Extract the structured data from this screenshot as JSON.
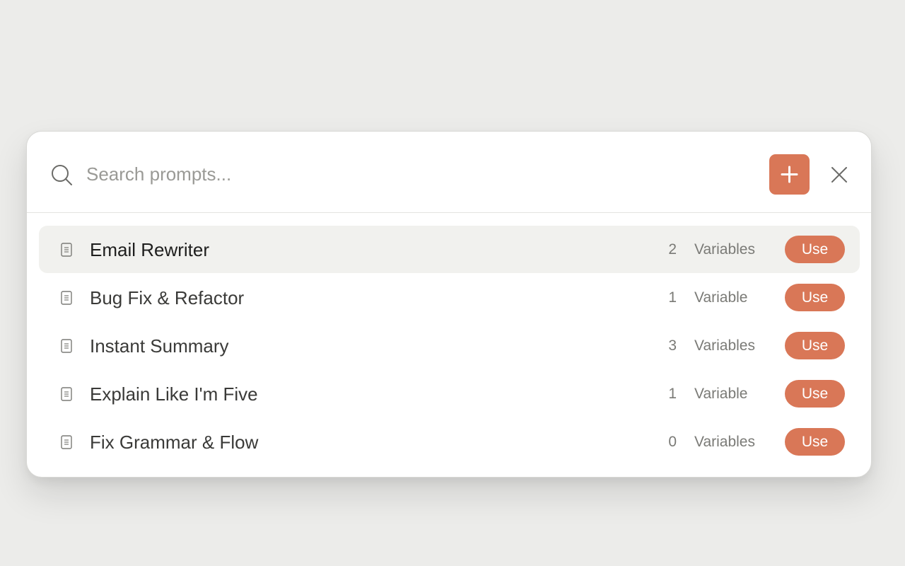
{
  "search": {
    "placeholder": "Search prompts..."
  },
  "toolbar": {
    "add_icon": "plus-icon",
    "close_icon": "close-icon"
  },
  "colors": {
    "accent": "#d97757",
    "active_row": "#f1f1ee",
    "background": "#ececea"
  },
  "prompts": [
    {
      "title": "Email Rewriter",
      "var_count": "2",
      "var_label": "Variables",
      "action": "Use",
      "active": true
    },
    {
      "title": "Bug Fix & Refactor",
      "var_count": "1",
      "var_label": "Variable",
      "action": "Use",
      "active": false
    },
    {
      "title": "Instant Summary",
      "var_count": "3",
      "var_label": "Variables",
      "action": "Use",
      "active": false
    },
    {
      "title": "Explain Like I'm Five",
      "var_count": "1",
      "var_label": "Variable",
      "action": "Use",
      "active": false
    },
    {
      "title": "Fix Grammar & Flow",
      "var_count": "0",
      "var_label": "Variables",
      "action": "Use",
      "active": false
    }
  ]
}
